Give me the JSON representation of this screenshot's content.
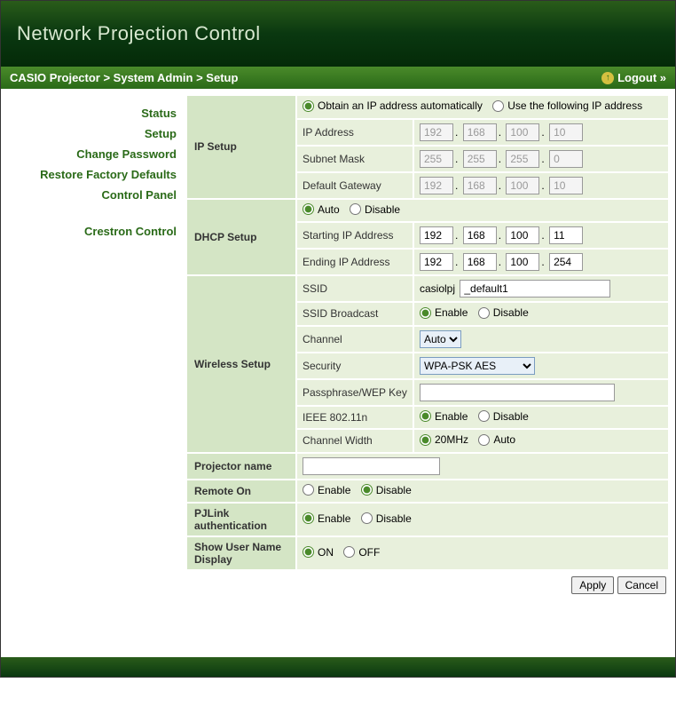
{
  "header": {
    "title": "Network Projection Control"
  },
  "breadcrumb": "CASIO Projector > System Admin > Setup",
  "logout": {
    "label": "Logout »",
    "icon": "up-arrow-icon"
  },
  "sidebar": {
    "items": [
      {
        "label": "Status"
      },
      {
        "label": "Setup"
      },
      {
        "label": "Change Password"
      },
      {
        "label": "Restore Factory Defaults"
      },
      {
        "label": "Control Panel"
      },
      {
        "label": "Crestron Control"
      }
    ]
  },
  "ip_setup": {
    "section_label": "IP Setup",
    "auto_label": "Obtain an IP address automatically",
    "manual_label": "Use the following IP address",
    "mode": "auto",
    "ip_address_label": "IP Address",
    "ip_address": [
      "192",
      "168",
      "100",
      "10"
    ],
    "subnet_label": "Subnet Mask",
    "subnet": [
      "255",
      "255",
      "255",
      "0"
    ],
    "gateway_label": "Default Gateway",
    "gateway": [
      "192",
      "168",
      "100",
      "10"
    ]
  },
  "dhcp": {
    "section_label": "DHCP Setup",
    "auto_label": "Auto",
    "disable_label": "Disable",
    "mode": "auto",
    "start_label": "Starting IP Address",
    "start": [
      "192",
      "168",
      "100",
      "11"
    ],
    "end_label": "Ending IP Address",
    "end": [
      "192",
      "168",
      "100",
      "254"
    ]
  },
  "wireless": {
    "section_label": "Wireless Setup",
    "ssid_label": "SSID",
    "ssid_prefix": "casiolpj",
    "ssid_value": "_default1",
    "broadcast_label": "SSID Broadcast",
    "enable_label": "Enable",
    "disable_label": "Disable",
    "broadcast": "enable",
    "channel_label": "Channel",
    "channel_value": "Auto",
    "security_label": "Security",
    "security_value": "WPA-PSK AES",
    "passphrase_label": "Passphrase/WEP Key",
    "passphrase_value": "",
    "ieee_label": "IEEE 802.11n",
    "ieee": "enable",
    "cw_label": "Channel Width",
    "cw_20_label": "20MHz",
    "cw_auto_label": "Auto",
    "cw": "20"
  },
  "projector": {
    "label": "Projector name",
    "value": ""
  },
  "remote_on": {
    "label": "Remote On",
    "enable_label": "Enable",
    "disable_label": "Disable",
    "value": "disable"
  },
  "pjlink": {
    "label": "PJLink authentication",
    "enable_label": "Enable",
    "disable_label": "Disable",
    "value": "enable"
  },
  "username_display": {
    "label": "Show User Name Display",
    "on_label": "ON",
    "off_label": "OFF",
    "value": "on"
  },
  "buttons": {
    "apply": "Apply",
    "cancel": "Cancel"
  }
}
